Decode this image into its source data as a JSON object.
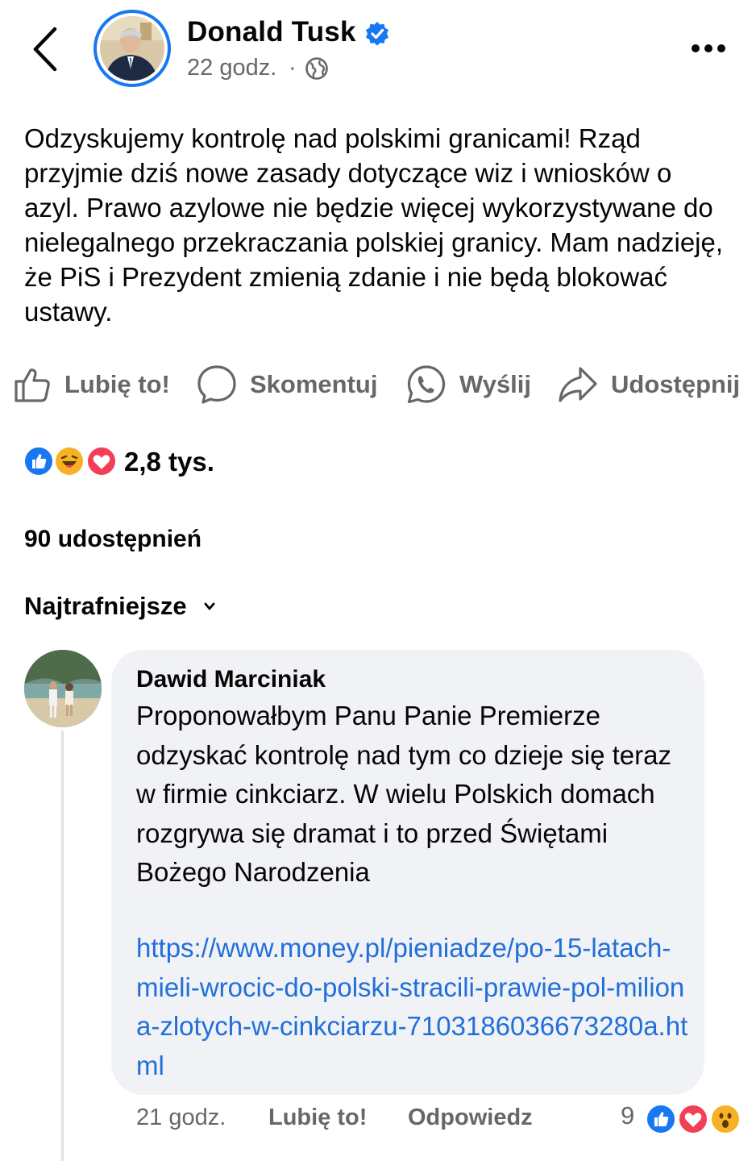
{
  "header": {
    "author_name": "Donald Tusk",
    "post_time": "22 godz.",
    "separator": "·",
    "back_icon": "chevron-left-icon",
    "verified_icon": "verified-badge-icon",
    "audience_icon": "globe-icon",
    "more_icon": "more-horizontal-icon"
  },
  "post": {
    "text": "Odzyskujemy kontrolę nad polskimi granicami! Rząd przyjmie dziś nowe zasady dotyczące wiz i wniosków o azyl. Prawo azylowe nie będzie więcej wykorzystywane do nielegalnego przekraczania polskiej granicy. Mam nadzieję, że PiS i Prezydent zmienią zdanie i nie będą blokować ustawy."
  },
  "actions": {
    "like": "Lubię to!",
    "comment": "Skomentuj",
    "send": "Wyślij",
    "share": "Udostępnij"
  },
  "stats": {
    "reactions_count": "2,8 tys.",
    "reaction_types": [
      "like",
      "haha",
      "love"
    ],
    "shares": "90 udostępnień"
  },
  "comments_sort": {
    "label": "Najtrafniejsze"
  },
  "comment": {
    "author": "Dawid Marciniak",
    "text": "Proponowałbym Panu Panie Premierze odzyskać kontrolę nad tym co dzieje się teraz w firmie cinkciarz. W wielu Polskich domach rozgrywa się dramat i to przed Świętami Bożego Narodzenia",
    "link": "https://www.money.pl/pieniadze/po-15-latach-mieli-wrocic-do-polski-stracili-prawie-pol-miliona-zlotych-w-cinkciarzu-7103186036673280a.html",
    "time": "21 godz.",
    "like_label": "Lubię to!",
    "reply_label": "Odpowiedz",
    "reaction_count": "9",
    "reaction_types": [
      "like",
      "love",
      "wow"
    ]
  },
  "colors": {
    "facebook_blue": "#1877f2",
    "link_blue": "#216fdb",
    "secondary_text": "#65676b",
    "bubble_bg": "#f0f2f5",
    "love_red": "#f33e58",
    "emoji_yellow": "#f7b125"
  }
}
